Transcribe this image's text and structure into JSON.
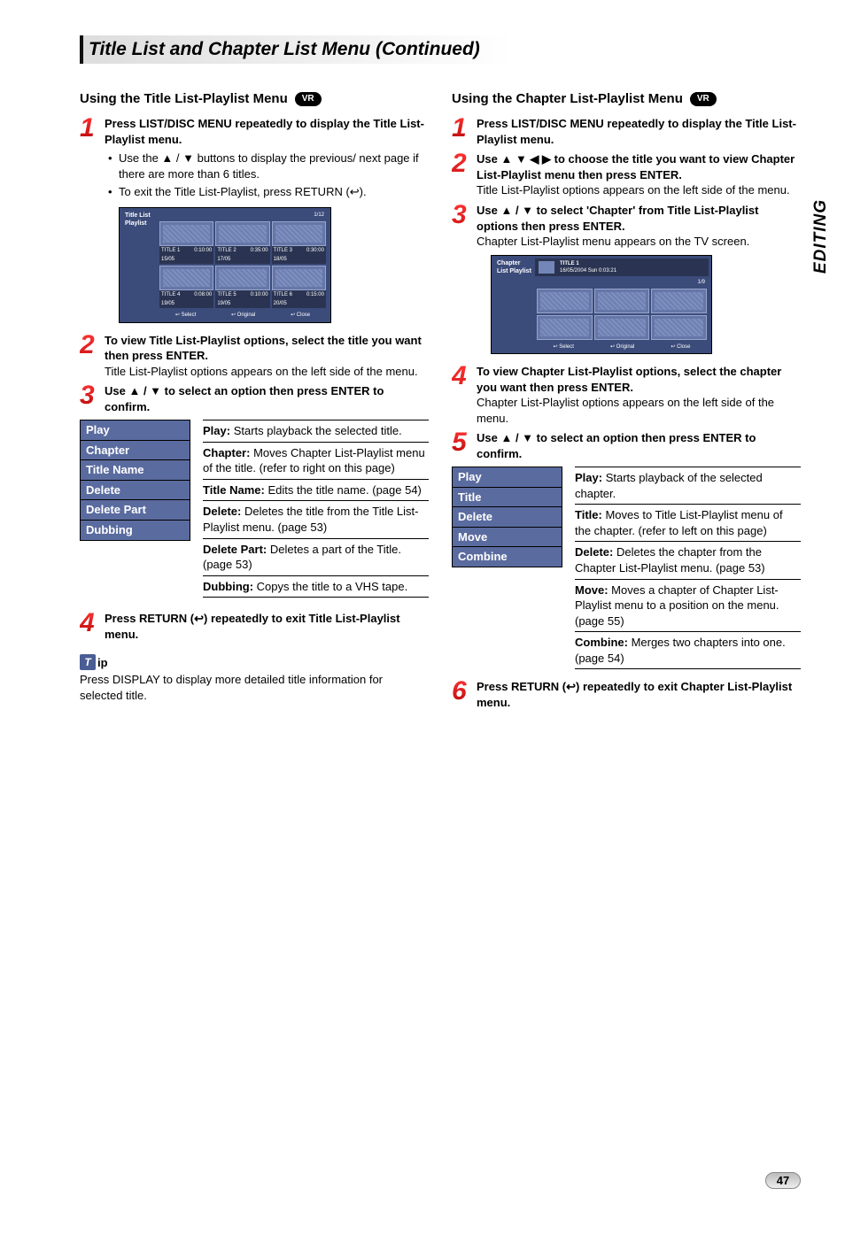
{
  "side_tab": "EDITING",
  "main_title": "Title List and Chapter List Menu (Continued)",
  "page_number": "47",
  "left": {
    "section_title": "Using the Title List-Playlist Menu",
    "vr": "VR",
    "steps": {
      "s1": {
        "bold": "Press LIST/DISC MENU repeatedly to display the Title List-Playlist menu."
      },
      "bul1": "Use the ▲ / ▼ buttons to display the previous/ next page if there are more than 6 titles.",
      "bul2": "To exit the Title List-Playlist, press RETURN (↩).",
      "s2": {
        "bold": "To view Title List-Playlist options, select the title you want then press ENTER.",
        "body": "Title List-Playlist options appears on the left side of the menu."
      },
      "s3": {
        "bold": "Use ▲ / ▼ to select an option then press ENTER to confirm."
      },
      "s4": {
        "bold": "Press RETURN (↩) repeatedly to exit Title List-Playlist menu."
      }
    },
    "osd": {
      "head": "Title List Playlist",
      "page": "1/12",
      "cells": [
        {
          "name": "TITLE 1",
          "d": "15/05",
          "t": "0:10:00"
        },
        {
          "name": "TITLE 2",
          "d": "17/05",
          "t": "0:35:00"
        },
        {
          "name": "TITLE 3",
          "d": "18/05",
          "t": "0:30:00"
        },
        {
          "name": "TITLE 4",
          "d": "19/05",
          "t": "0:08:00"
        },
        {
          "name": "TITLE 5",
          "d": "19/05",
          "t": "0:10:00"
        },
        {
          "name": "TITLE 6",
          "d": "20/05",
          "t": "0:15:00"
        }
      ],
      "foot": [
        "Select",
        "Original",
        "Close"
      ]
    },
    "options": [
      "Play",
      "Chapter",
      "Title Name",
      "Delete",
      "Delete Part",
      "Dubbing"
    ],
    "descs": [
      {
        "h": "Play:",
        "b": " Starts playback the selected title."
      },
      {
        "h": "Chapter:",
        "b": " Moves Chapter List-Playlist menu of the title. (refer to right on this page)"
      },
      {
        "h": "Title Name:",
        "b": " Edits the title name. (page 54)"
      },
      {
        "h": "Delete:",
        "b": " Deletes the title from the Title List-Playlist menu. (page 53)"
      },
      {
        "h": "Delete Part:",
        "b": " Deletes a part of the Title. (page 53)"
      },
      {
        "h": "Dubbing:",
        "b": " Copys the title to a VHS tape."
      }
    ],
    "tip_head": "ip",
    "tip_body": "Press DISPLAY to display more detailed title information for selected title."
  },
  "right": {
    "section_title": "Using the Chapter List-Playlist Menu",
    "vr": "VR",
    "steps": {
      "s1": {
        "bold": "Press LIST/DISC MENU repeatedly to display the Title List-Playlist menu."
      },
      "s2": {
        "bold": "Use ▲ ▼ ◀ ▶ to choose the title you want to view Chapter List-Playlist menu then press ENTER.",
        "body": "Title List-Playlist options appears on the left side of the menu."
      },
      "s3": {
        "bold": "Use ▲ / ▼ to select 'Chapter' from Title List-Playlist options then press ENTER.",
        "body": "Chapter List-Playlist menu appears on the TV screen."
      },
      "s4": {
        "bold": "To view Chapter List-Playlist options, select the chapter you want then press ENTER.",
        "body": "Chapter List-Playlist options appears on the left side of the menu."
      },
      "s5": {
        "bold": "Use ▲ / ▼ to select an option then press ENTER to confirm."
      },
      "s6": {
        "bold": "Press RETURN (↩) repeatedly to exit Chapter List-Playlist menu."
      }
    },
    "osd": {
      "head": "Chapter List Playlist",
      "strip_title": "TITLE 1",
      "strip_sub": "16/05/2004  Sun  0:03:21",
      "page": "1/9",
      "foot": [
        "Select",
        "Original",
        "Close"
      ]
    },
    "options": [
      "Play",
      "Title",
      "Delete",
      "Move",
      "Combine"
    ],
    "descs": [
      {
        "h": "Play:",
        "b": " Starts playback of the selected chapter."
      },
      {
        "h": "Title:",
        "b": " Moves to Title List-Playlist menu of the chapter. (refer to left on this page)"
      },
      {
        "h": "Delete:",
        "b": " Deletes the chapter from the Chapter List-Playlist menu. (page 53)"
      },
      {
        "h": "Move:",
        "b": " Moves a chapter of Chapter List-Playlist menu to a position on the menu. (page 55)"
      },
      {
        "h": "Combine:",
        "b": " Merges two chapters into one. (page 54)"
      }
    ]
  }
}
